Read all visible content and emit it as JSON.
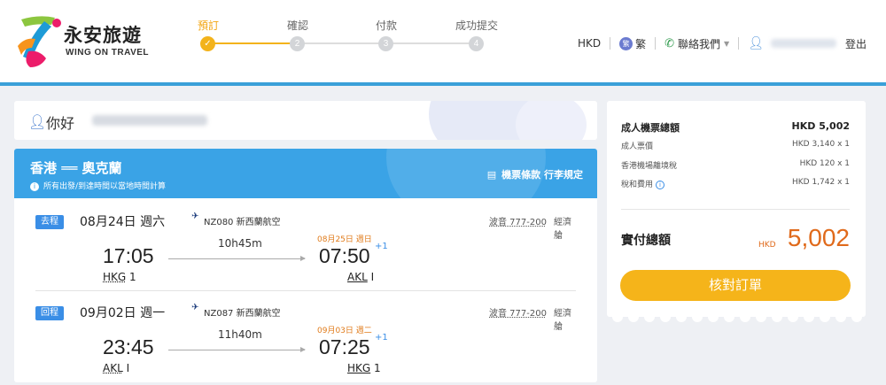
{
  "brand": {
    "name_cn": "永安旅遊",
    "name_en": "WING ON TRAVEL"
  },
  "steps": [
    {
      "label": "預訂",
      "number": "✓",
      "active": true
    },
    {
      "label": "確認",
      "number": "2",
      "active": false
    },
    {
      "label": "付款",
      "number": "3",
      "active": false
    },
    {
      "label": "成功提交",
      "number": "4",
      "active": false
    }
  ],
  "nav": {
    "currency": "HKD",
    "lang_badge": "繁",
    "lang_label": "繁",
    "contact_label": "聯絡我們",
    "logout_label": "登出"
  },
  "greeting": {
    "text": "你好"
  },
  "route": {
    "title": "香港 ══ 奧克蘭",
    "note": "所有出發/到達時間以當地時間計算",
    "links_label": "機票條款 行李規定"
  },
  "legs": [
    {
      "tag": "去程",
      "date": "08月24日 週六",
      "flight": "NZ080 新西蘭航空",
      "aircraft": "波音 777-200",
      "cabin": "經濟艙",
      "dep_time": "17:05",
      "dep_airport": "HKG",
      "dep_terminal": "1",
      "duration": "10h45m",
      "arr_date": "08月25日 週日",
      "arr_time": "07:50",
      "plus_days": "+1",
      "arr_airport": "AKL",
      "arr_terminal": "I"
    },
    {
      "tag": "回程",
      "date": "09月02日 週一",
      "flight": "NZ087 新西蘭航空",
      "aircraft": "波音 777-200",
      "cabin": "經濟艙",
      "dep_time": "23:45",
      "dep_airport": "AKL",
      "dep_terminal": "I",
      "duration": "11h40m",
      "arr_date": "09月03日 週二",
      "arr_time": "07:25",
      "plus_days": "+1",
      "arr_airport": "HKG",
      "arr_terminal": "1"
    }
  ],
  "price": {
    "adult_total_label": "成人機票總額",
    "adult_total_value": "HKD 5,002",
    "fare_label": "成人票價",
    "fare_value": "HKD 3,140 x 1",
    "airport_tax_label": "香港機場離境稅",
    "airport_tax_value": "HKD 120 x 1",
    "taxes_fees_label": "稅和費用",
    "taxes_fees_value": "HKD 1,742 x 1",
    "total_label": "實付總額",
    "total_currency": "HKD",
    "total_value": "5,002",
    "confirm_label": "核對訂單"
  },
  "colors": {
    "accent_orange": "#f5b41a",
    "primary_blue": "#3aa3e6",
    "price_orange": "#e06a1b"
  }
}
